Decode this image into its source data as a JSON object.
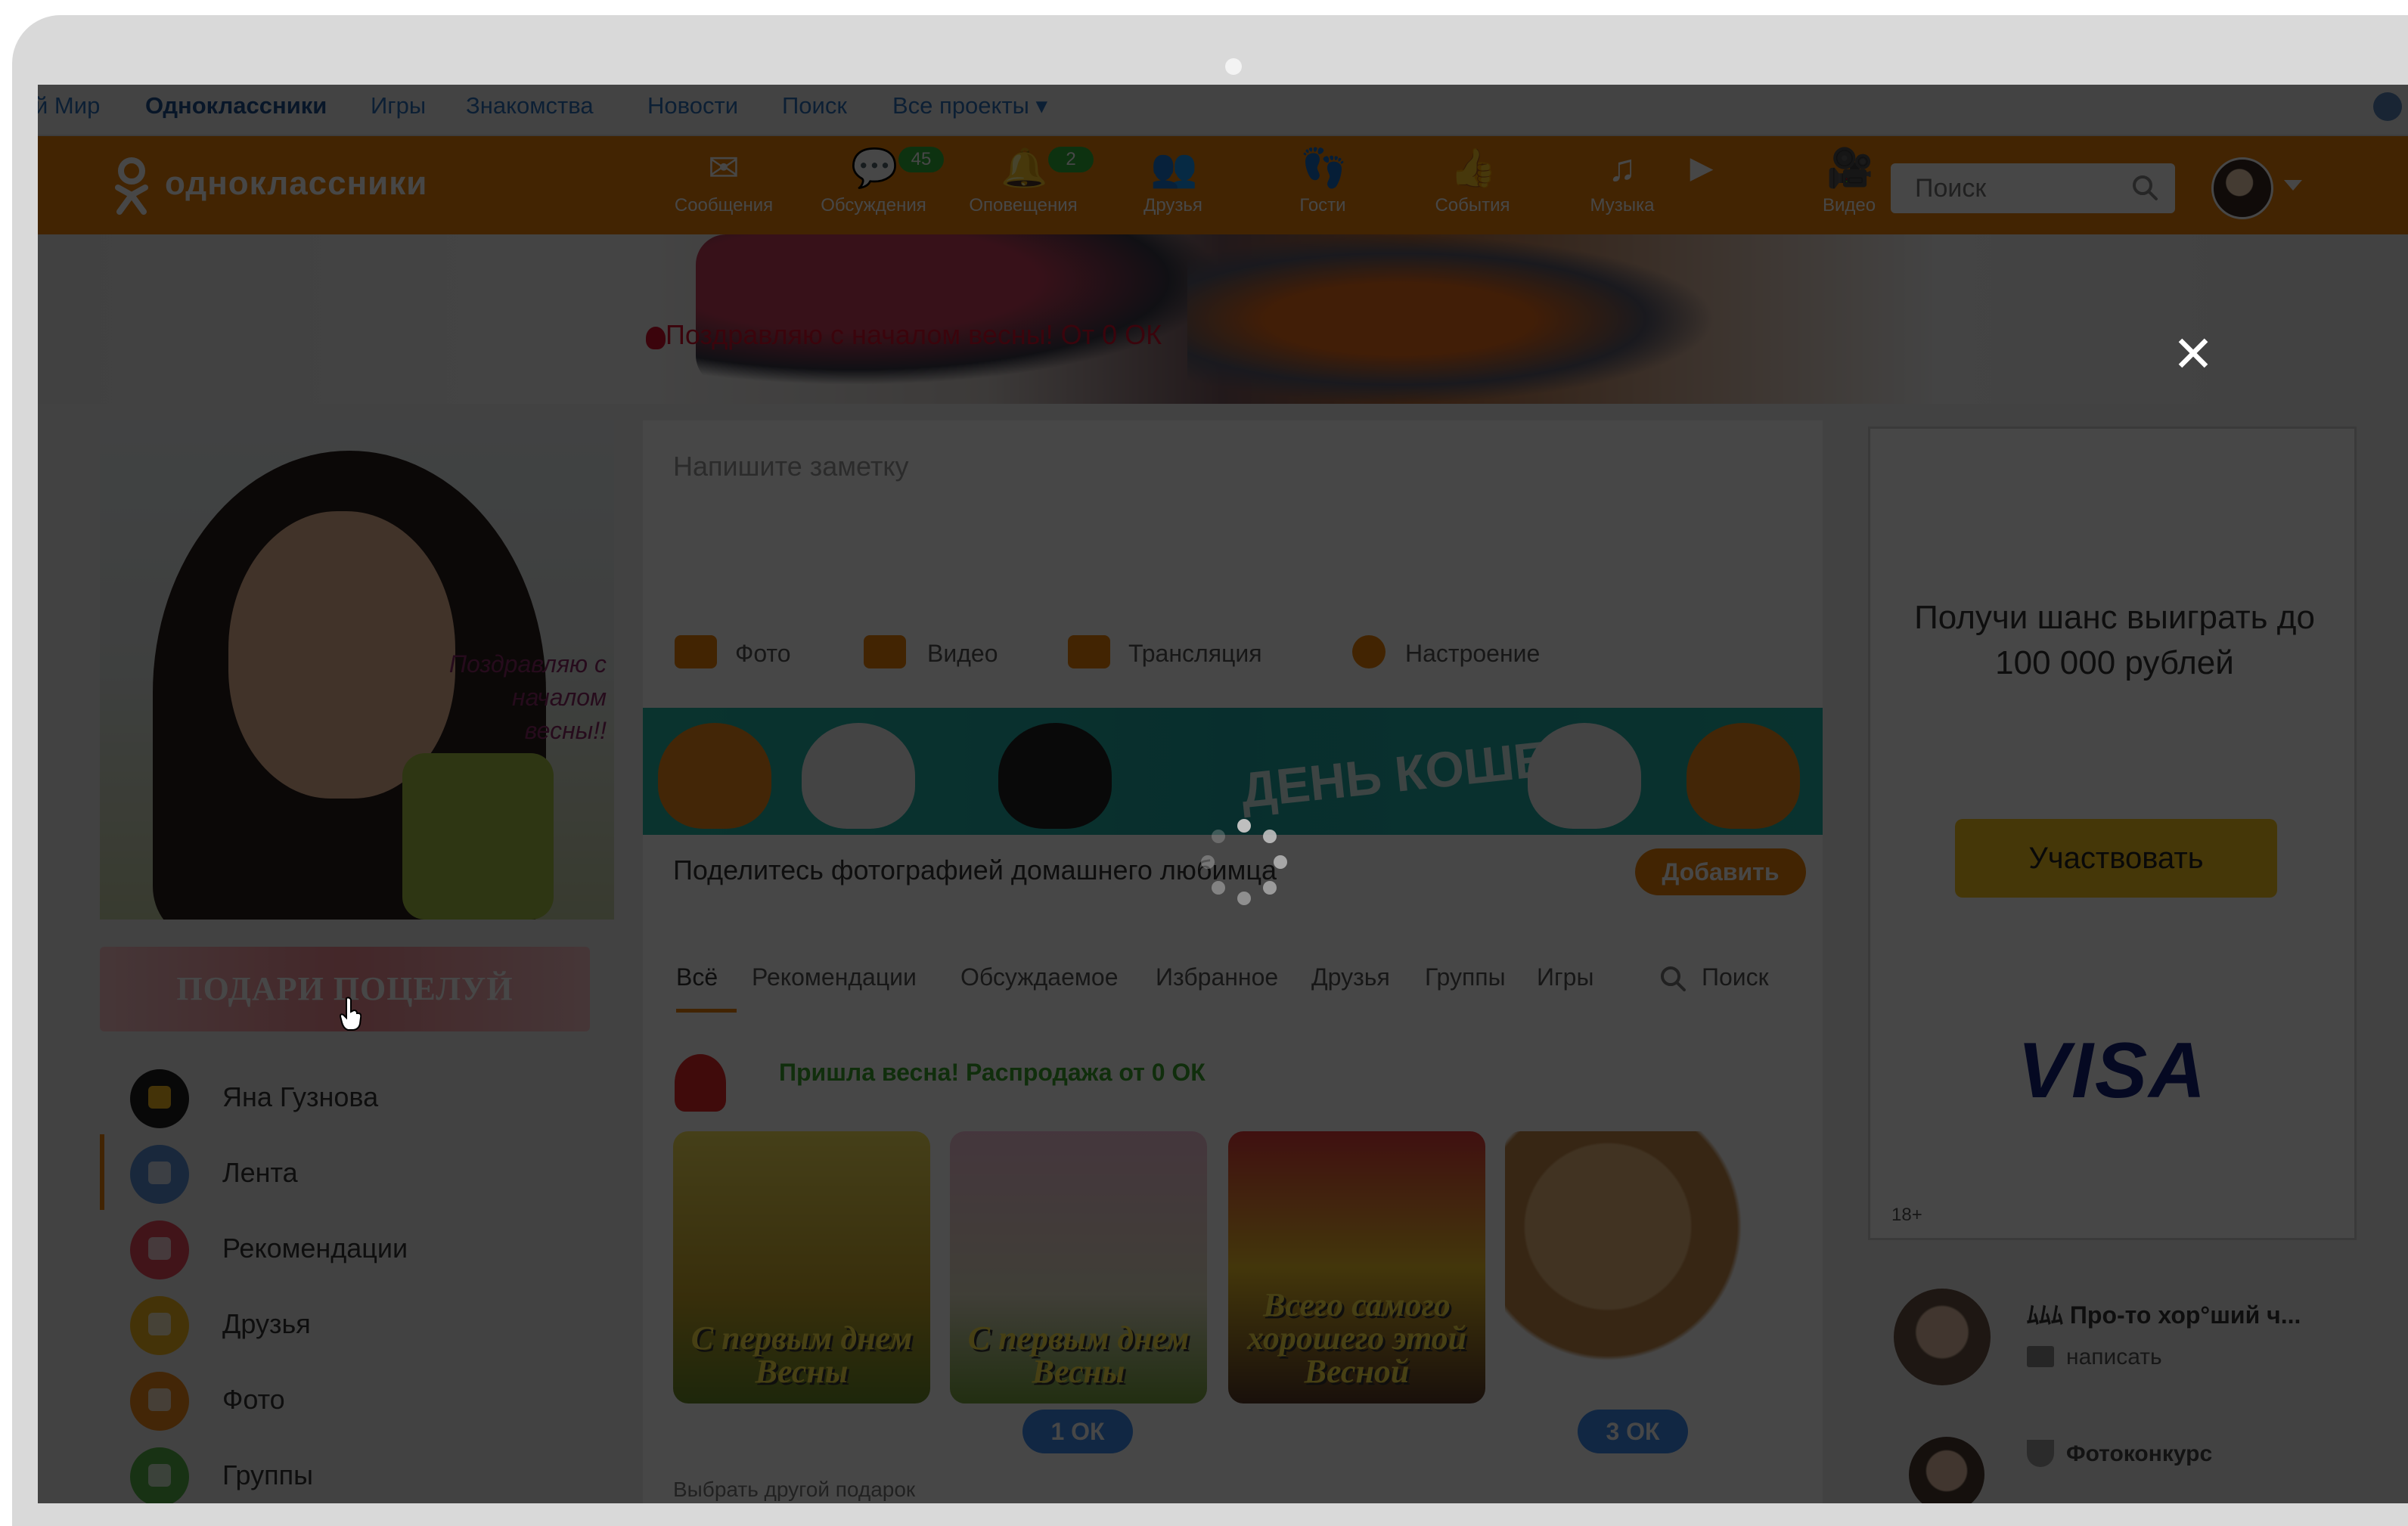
{
  "portal": {
    "items": [
      "й Мир",
      "Одноклассники",
      "Игры",
      "Знакомства",
      "Новости",
      "Поиск",
      "Все проекты"
    ]
  },
  "header": {
    "logo": "одноклассники",
    "nav": [
      {
        "label": "Сообщения",
        "icon": "envelope-icon",
        "badge": ""
      },
      {
        "label": "Обсуждения",
        "icon": "chat-icon",
        "badge": "45"
      },
      {
        "label": "Оповещения",
        "icon": "bell-icon",
        "badge": "2"
      },
      {
        "label": "Друзья",
        "icon": "friends-icon",
        "badge": ""
      },
      {
        "label": "Гости",
        "icon": "footprints-icon",
        "badge": ""
      },
      {
        "label": "События",
        "icon": "events-icon",
        "badge": ""
      },
      {
        "label": "Музыка",
        "icon": "music-icon",
        "badge": ""
      },
      {
        "label": "Видео",
        "icon": "video-icon",
        "badge": ""
      }
    ],
    "search_placeholder": "Поиск"
  },
  "banner": {
    "text": "Поздравляю с началом весны! От 0 ОК"
  },
  "profile": {
    "photo_caption": "Поздравляю с началом весны!!",
    "kiss_button": "ПОДАРИ ПОЦЕЛУЙ"
  },
  "menu": [
    {
      "label": "Яна Гузнова",
      "color": "#1e1e1e"
    },
    {
      "label": "Лента",
      "color": "#5b8fd6"
    },
    {
      "label": "Рекомендации",
      "color": "#e8485c"
    },
    {
      "label": "Друзья",
      "color": "#f4b81e"
    },
    {
      "label": "Фото",
      "color": "#f08a1c"
    },
    {
      "label": "Группы",
      "color": "#58b349"
    }
  ],
  "note": {
    "placeholder": "Напишите заметку",
    "actions": [
      "Фото",
      "Видео",
      "Трансляция",
      "Настроение"
    ]
  },
  "cats_banner": {
    "title": "ДЕНЬ КОШЕК"
  },
  "share": {
    "text": "Поделитесь фотографией домашнего любимца",
    "button": "Добавить"
  },
  "tabs": {
    "items": [
      "Всё",
      "Рекомендации",
      "Обсуждаемое",
      "Избранное",
      "Друзья",
      "Группы",
      "Игры"
    ],
    "search": "Поиск"
  },
  "gifts": {
    "promo": "Пришла весна! Распродажа от 0 ОК",
    "items": [
      {
        "text": "С первым днем Весны",
        "price": ""
      },
      {
        "text": "С первым днем Весны",
        "price": "1 ОК"
      },
      {
        "text": "Всего самого хорошего этой Весной",
        "price": ""
      },
      {
        "text": "",
        "price": "3 ОК"
      }
    ],
    "other": "Выбрать другой подарок"
  },
  "ad": {
    "headline": "Получи шанс выиграть до 100 000 рублей",
    "cta": "Участвовать",
    "brand": "VISA",
    "age": "18+"
  },
  "friend": {
    "name": "ﾑﾑﾑ Про-то хор°ший ч...",
    "write": "написать",
    "contest": "Фотоконкурс"
  },
  "colors": {
    "accent": "#ee8208",
    "badge": "#30b53c",
    "price": "#3d8df0"
  }
}
